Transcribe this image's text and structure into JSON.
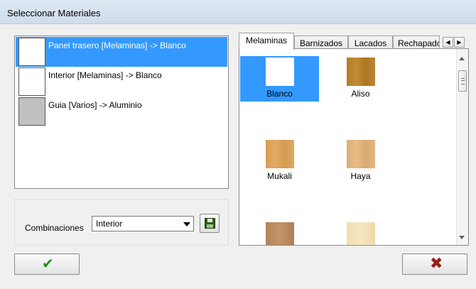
{
  "window": {
    "title": "Seleccionar Materiales"
  },
  "materials_list": [
    {
      "label": "Panel trasero [Melaminas] -> Blanco",
      "selected": true,
      "swatch": "#ffffff"
    },
    {
      "label": "Interior [Melaminas] -> Blanco",
      "selected": false,
      "swatch": "#ffffff"
    },
    {
      "label": "Guia [Varios] -> Aluminio",
      "selected": false,
      "swatch": "#c0c0c0"
    }
  ],
  "combinaciones": {
    "label": "Combinaciones",
    "selected": "Interior",
    "save_icon": "floppy-disk-icon"
  },
  "tabs": [
    {
      "label": "Melaminas",
      "active": true
    },
    {
      "label": "Barnizados",
      "active": false
    },
    {
      "label": "Lacados",
      "active": false
    },
    {
      "label": "Rechapados",
      "active": false
    }
  ],
  "textures": [
    {
      "label": "Blanco",
      "color": "#ffffff",
      "selected": true
    },
    {
      "label": "Aliso",
      "color": "#b8842e",
      "selected": false
    },
    {
      "label": "Mukali",
      "color": "#dca45c",
      "selected": false
    },
    {
      "label": "Haya",
      "color": "#e0b47e",
      "selected": false
    },
    {
      "label": "",
      "color": "#b98a5e",
      "selected": false
    },
    {
      "label": "",
      "color": "#f3e2b6",
      "selected": false
    }
  ],
  "buttons": {
    "ok_icon": "checkmark-icon",
    "cancel_icon": "close-x-icon",
    "ok_glyph": "✔",
    "cancel_glyph": "✖"
  },
  "colors": {
    "selection": "#3399ff",
    "ok": "#1f8f1f",
    "cancel": "#9c1c1c"
  }
}
